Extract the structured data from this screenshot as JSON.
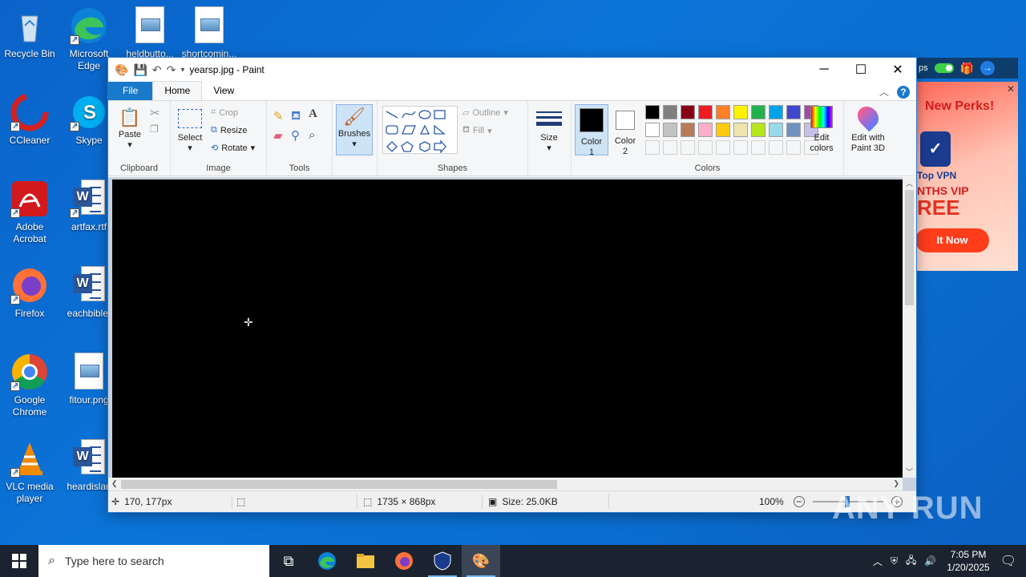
{
  "desktop": {
    "icons_col1": [
      {
        "label": "Recycle Bin",
        "icon": "recycle-bin-icon"
      },
      {
        "label": "CCleaner",
        "icon": "ccleaner-icon"
      },
      {
        "label": "Adobe Acrobat",
        "icon": "acrobat-icon"
      },
      {
        "label": "Firefox",
        "icon": "firefox-icon"
      },
      {
        "label": "Google Chrome",
        "icon": "chrome-icon"
      },
      {
        "label": "VLC media player",
        "icon": "vlc-icon"
      }
    ],
    "icons_col2": [
      {
        "label": "Microsoft Edge",
        "icon": "edge-icon"
      },
      {
        "label": "Skype",
        "icon": "skype-icon"
      },
      {
        "label": "artfax.rtf",
        "icon": "word-doc-icon"
      },
      {
        "label": "eachbible.",
        "icon": "word-doc-icon"
      },
      {
        "label": "fitour.png",
        "icon": "image-file-icon"
      },
      {
        "label": "heardislan",
        "icon": "word-doc-icon"
      }
    ],
    "icons_top": [
      {
        "label": "heldbutto...",
        "icon": "image-file-icon"
      },
      {
        "label": "shortcomin...",
        "icon": "image-file-icon"
      }
    ]
  },
  "paint": {
    "title": "yearsp.jpg - Paint",
    "tabs": {
      "file": "File",
      "home": "Home",
      "view": "View"
    },
    "clipboard": {
      "paste": "Paste",
      "label": "Clipboard"
    },
    "image": {
      "select": "Select",
      "crop": "Crop",
      "resize": "Resize",
      "rotate": "Rotate",
      "label": "Image"
    },
    "tools": {
      "label": "Tools"
    },
    "brushes": "Brushes",
    "shapes": {
      "outline": "Outline",
      "fill": "Fill",
      "label": "Shapes"
    },
    "size": "Size",
    "color1": "Color 1",
    "color2": "Color 2",
    "colors_label": "Colors",
    "edit_colors": "Edit colors",
    "edit_3d": "Edit with Paint 3D",
    "palette_row1": [
      "#000000",
      "#7f7f7f",
      "#880015",
      "#ed1c24",
      "#ff7f27",
      "#fff200",
      "#22b14c",
      "#00a2e8",
      "#3f48cc",
      "#a349a4"
    ],
    "palette_row2": [
      "#ffffff",
      "#c3c3c3",
      "#b97a57",
      "#ffaec9",
      "#ffc90e",
      "#efe4b0",
      "#b5e61d",
      "#99d9ea",
      "#7092be",
      "#c8bfe7"
    ],
    "status": {
      "cursor": "170, 177px",
      "dimensions": "1735 × 868px",
      "size": "Size: 25.0KB",
      "zoom": "100%"
    }
  },
  "ad": {
    "bar_text": "ps",
    "headline": "New Perks!",
    "brand": "Top VPN",
    "months": "NTHS VIP",
    "free": "REE",
    "cta": "It Now"
  },
  "watermark": "ANY RUN",
  "taskbar": {
    "search_placeholder": "Type here to search",
    "time": "7:05 PM",
    "date": "1/20/2025"
  }
}
